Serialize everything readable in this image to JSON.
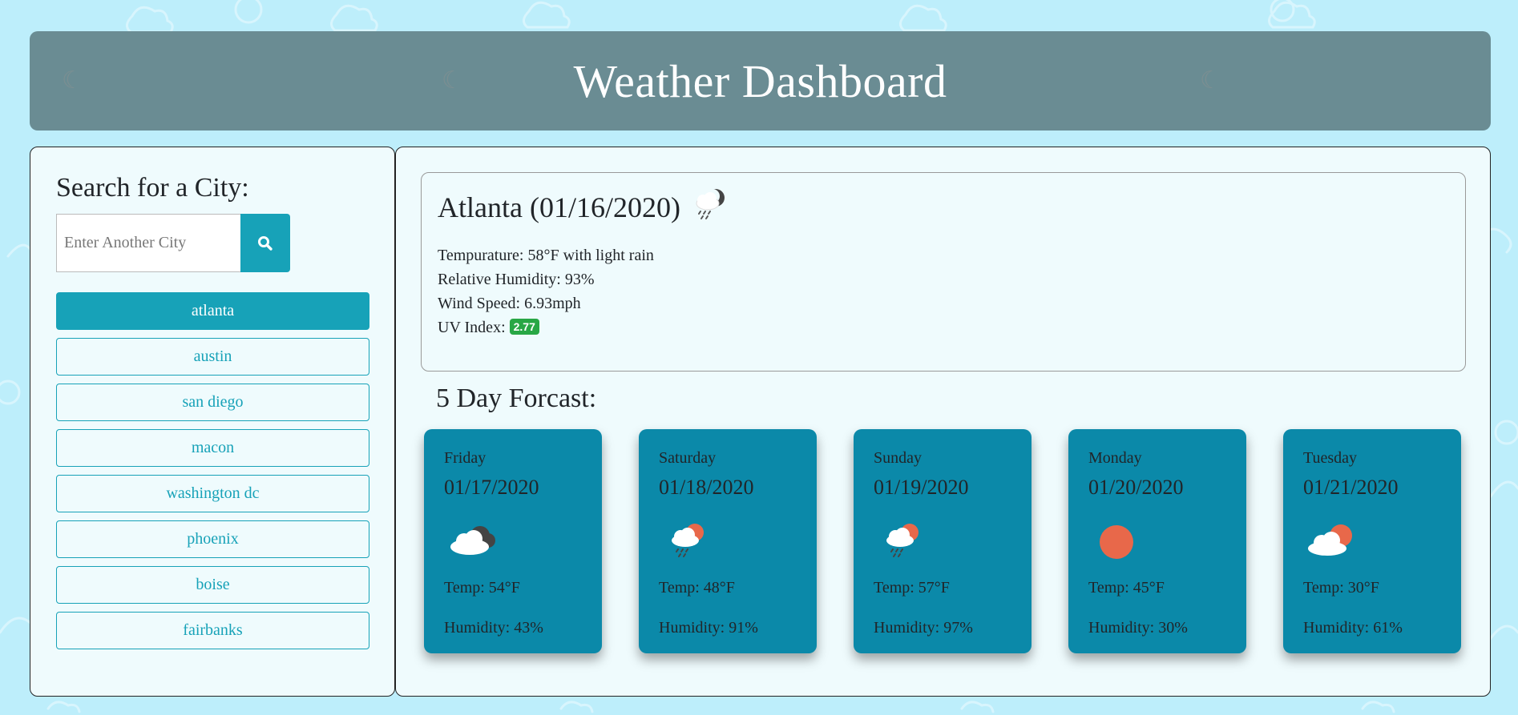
{
  "header": {
    "title": "Weather Dashboard"
  },
  "sidebar": {
    "heading": "Search for a City:",
    "search": {
      "placeholder": "Enter Another City",
      "value": ""
    },
    "cities": [
      {
        "label": "atlanta",
        "active": true
      },
      {
        "label": "austin",
        "active": false
      },
      {
        "label": "san diego",
        "active": false
      },
      {
        "label": "macon",
        "active": false
      },
      {
        "label": "washington dc",
        "active": false
      },
      {
        "label": "phoenix",
        "active": false
      },
      {
        "label": "boise",
        "active": false
      },
      {
        "label": "fairbanks",
        "active": false
      }
    ]
  },
  "current": {
    "title": "Atlanta (01/16/2020)",
    "icon": "night-rain-icon",
    "temperature": "Tempurature: 58°F with light rain",
    "humidity": "Relative Humidity: 93%",
    "wind": "Wind Speed: 6.93mph",
    "uv_label": "UV Index:",
    "uv_value": "2.77"
  },
  "forecast": {
    "title": "5 Day Forcast:",
    "days": [
      {
        "day": "Friday",
        "date": "01/17/2020",
        "icon": "cloudy-night-icon",
        "temp": "Temp: 54°F",
        "humidity": "Humidity: 43%"
      },
      {
        "day": "Saturday",
        "date": "01/18/2020",
        "icon": "rain-sun-icon",
        "temp": "Temp: 48°F",
        "humidity": "Humidity: 91%"
      },
      {
        "day": "Sunday",
        "date": "01/19/2020",
        "icon": "rain-sun-icon",
        "temp": "Temp: 57°F",
        "humidity": "Humidity: 97%"
      },
      {
        "day": "Monday",
        "date": "01/20/2020",
        "icon": "sun-icon",
        "temp": "Temp: 45°F",
        "humidity": "Humidity: 30%"
      },
      {
        "day": "Tuesday",
        "date": "01/21/2020",
        "icon": "partly-cloudy-icon",
        "temp": "Temp: 30°F",
        "humidity": "Humidity: 61%"
      }
    ]
  },
  "colors": {
    "accent": "#17a2b8",
    "card": "#0b89a9",
    "header": "#6a8c93",
    "uv_good": "#28a745",
    "background": "#bdeefb"
  }
}
